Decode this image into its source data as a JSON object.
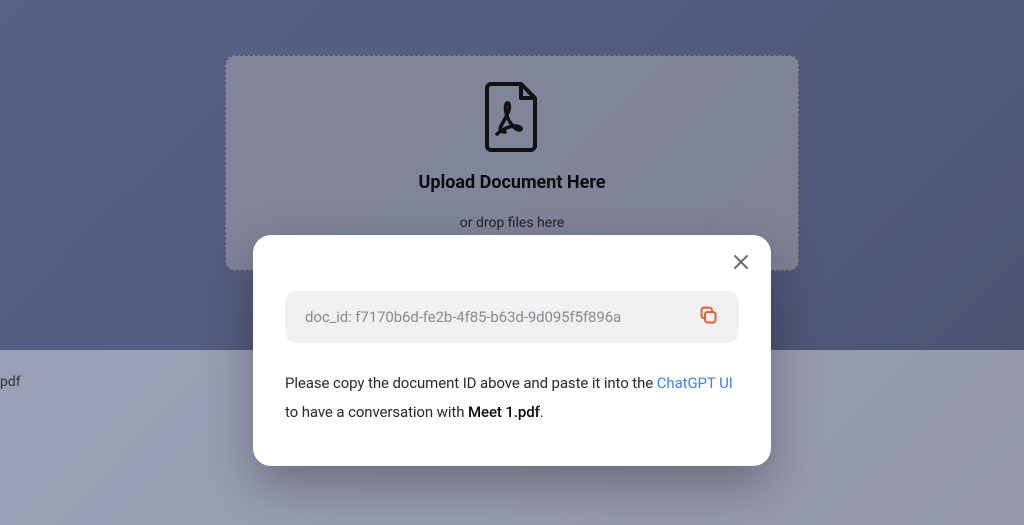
{
  "dropzone": {
    "title": "Upload Document Here",
    "subtitle": "or drop files here"
  },
  "bottom": {
    "partial_filename": "pdf"
  },
  "modal": {
    "docid_label": "doc_id: f7170b6d-fe2b-4f85-b63d-9d095f5f896a",
    "instruction_part1": "Please copy the document ID above and paste it into the ",
    "link_text": "ChatGPT UI",
    "instruction_part2": " to have a conversation with ",
    "filename": "Meet 1.pdf",
    "instruction_end": "."
  }
}
